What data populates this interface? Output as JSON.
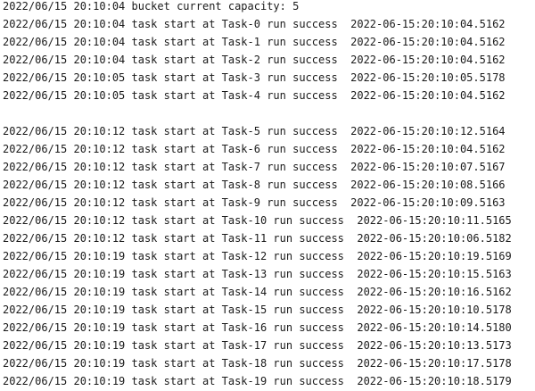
{
  "console": {
    "lines": [
      "2022/06/15 20:10:04 bucket current capacity: 5",
      "2022/06/15 20:10:04 task start at Task-0 run success  2022-06-15:20:10:04.5162",
      "2022/06/15 20:10:04 task start at Task-1 run success  2022-06-15:20:10:04.5162",
      "2022/06/15 20:10:04 task start at Task-2 run success  2022-06-15:20:10:04.5162",
      "2022/06/15 20:10:05 task start at Task-3 run success  2022-06-15:20:10:05.5178",
      "2022/06/15 20:10:05 task start at Task-4 run success  2022-06-15:20:10:04.5162",
      "",
      "2022/06/15 20:10:12 task start at Task-5 run success  2022-06-15:20:10:12.5164",
      "2022/06/15 20:10:12 task start at Task-6 run success  2022-06-15:20:10:04.5162",
      "2022/06/15 20:10:12 task start at Task-7 run success  2022-06-15:20:10:07.5167",
      "2022/06/15 20:10:12 task start at Task-8 run success  2022-06-15:20:10:08.5166",
      "2022/06/15 20:10:12 task start at Task-9 run success  2022-06-15:20:10:09.5163",
      "2022/06/15 20:10:12 task start at Task-10 run success  2022-06-15:20:10:11.5165",
      "2022/06/15 20:10:12 task start at Task-11 run success  2022-06-15:20:10:06.5182",
      "2022/06/15 20:10:19 task start at Task-12 run success  2022-06-15:20:10:19.5169",
      "2022/06/15 20:10:19 task start at Task-13 run success  2022-06-15:20:10:15.5163",
      "2022/06/15 20:10:19 task start at Task-14 run success  2022-06-15:20:10:16.5162",
      "2022/06/15 20:10:19 task start at Task-15 run success  2022-06-15:20:10:10.5178",
      "2022/06/15 20:10:19 task start at Task-16 run success  2022-06-15:20:10:14.5180",
      "2022/06/15 20:10:19 task start at Task-17 run success  2022-06-15:20:10:13.5173",
      "2022/06/15 20:10:19 task start at Task-18 run success  2022-06-15:20:10:17.5178",
      "2022/06/15 20:10:19 task start at Task-19 run success  2022-06-15:20:10:18.5179"
    ]
  }
}
